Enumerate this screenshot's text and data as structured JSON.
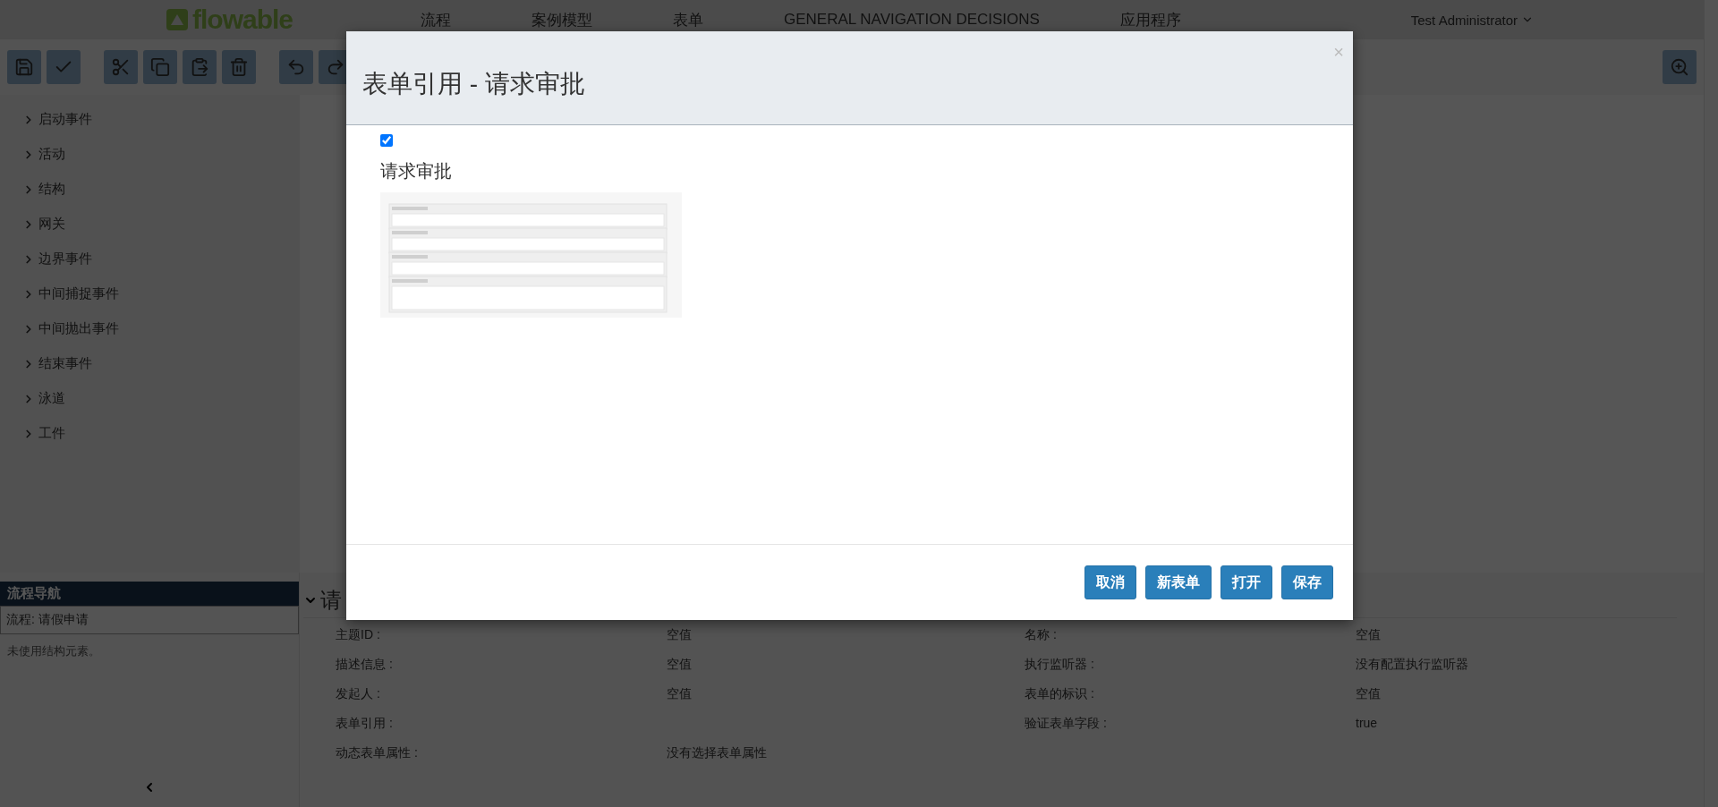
{
  "navbar": {
    "logo": "flowable",
    "items": [
      {
        "label": "流程"
      },
      {
        "label": "案例模型"
      },
      {
        "label": "表单"
      },
      {
        "label": "GENERAL NAVIGATION DECISIONS"
      },
      {
        "label": "应用程序"
      }
    ],
    "user": "Test Administrator"
  },
  "palette": {
    "items": [
      {
        "label": "启动事件"
      },
      {
        "label": "活动"
      },
      {
        "label": "结构"
      },
      {
        "label": "网关"
      },
      {
        "label": "边界事件"
      },
      {
        "label": "中间捕捉事件"
      },
      {
        "label": "中间抛出事件"
      },
      {
        "label": "结束事件"
      },
      {
        "label": "泳道"
      },
      {
        "label": "工件"
      }
    ]
  },
  "navigator": {
    "title": "流程导航",
    "process": "流程: 请假申请",
    "note": "未使用结构元素。"
  },
  "properties": {
    "title": "请",
    "items": [
      {
        "label": "主题ID :",
        "value": "空值"
      },
      {
        "label": "名称 :",
        "value": "空值"
      },
      {
        "label": "描述信息 :",
        "value": "空值"
      },
      {
        "label": "执行监听器 :",
        "value": "没有配置执行监听器"
      },
      {
        "label": "发起人 :",
        "value": "空值"
      },
      {
        "label": "表单的标识 :",
        "value": "空值"
      },
      {
        "label": "表单引用 :"
      },
      {
        "label": "验证表单字段 :",
        "value": "true"
      },
      {
        "label": "动态表单属性 :",
        "value": "没有选择表单属性"
      }
    ]
  },
  "modal": {
    "title": "表单引用 - 请求审批",
    "close": "×",
    "checked": true,
    "form_name": "请求审批",
    "buttons": [
      {
        "label": "取消"
      },
      {
        "label": "新表单"
      },
      {
        "label": "打开"
      },
      {
        "label": "保存"
      }
    ]
  }
}
